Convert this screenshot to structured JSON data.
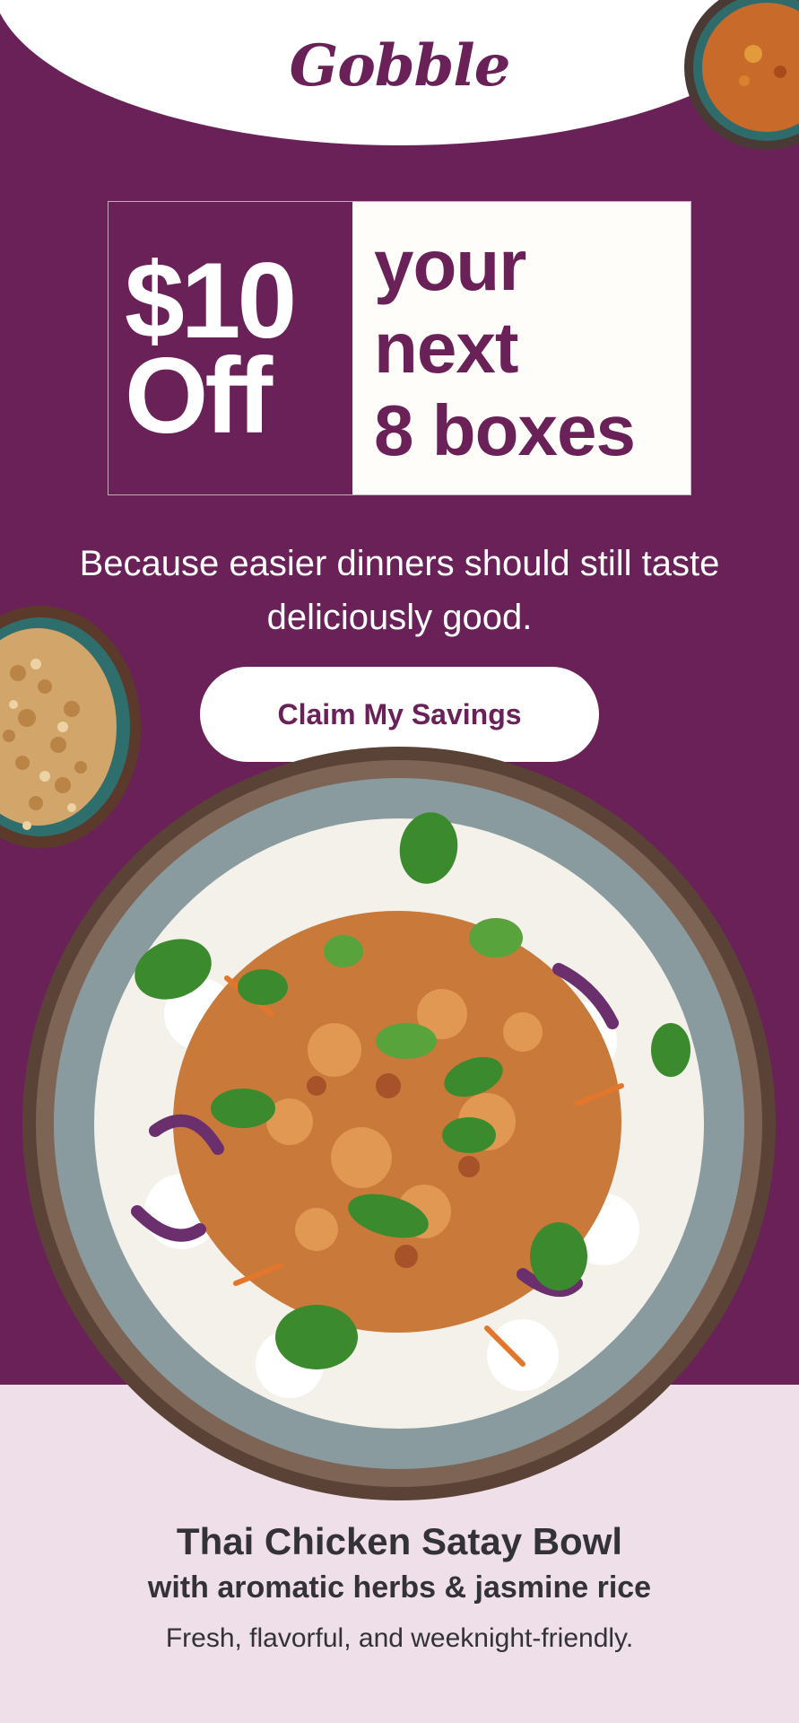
{
  "brand": {
    "logo_text": "Gobble",
    "color": "#6a2158",
    "light_color": "#efdfe9"
  },
  "offer": {
    "amount": "$10",
    "label": "Off",
    "lines": [
      "your",
      "next",
      "8 boxes"
    ]
  },
  "tagline": "Because easier dinners should still taste deliciously good.",
  "cta": {
    "label": "Claim My Savings"
  },
  "images": {
    "sauce_bowl": "dipping-sauce-bowl",
    "peanut_bowl": "chopped-peanuts-bowl",
    "main_bowl": "thai-chicken-satay-bowl-photo"
  },
  "dish": {
    "title": "Thai Chicken Satay Bowl",
    "subtitle": "with aromatic herbs & jasmine rice",
    "note": "Fresh, flavorful, and weeknight-friendly."
  }
}
